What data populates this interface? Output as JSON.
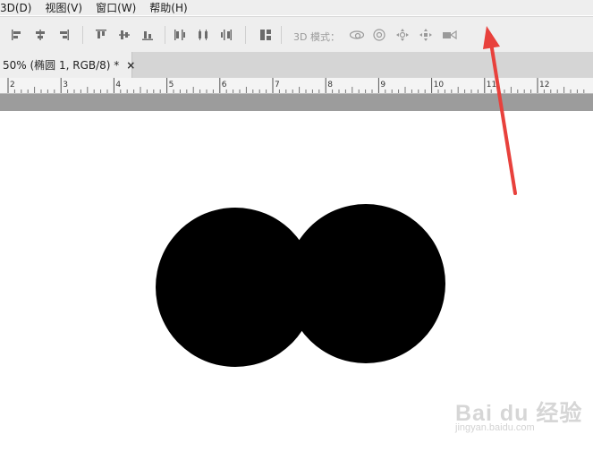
{
  "menubar": {
    "items": [
      {
        "label": "3D(D)"
      },
      {
        "label": "视图(V)"
      },
      {
        "label": "窗口(W)"
      },
      {
        "label": "帮助(H)"
      }
    ]
  },
  "options_bar": {
    "mode_label": "3D 模式：",
    "icons": [
      "align-left-edges-icon",
      "align-horizontal-centers-icon",
      "align-right-edges-icon",
      "align-top-edges-icon",
      "align-vertical-centers-icon",
      "align-bottom-edges-icon",
      "distribute-left-icon",
      "distribute-horizontal-centers-icon",
      "distribute-right-icon",
      "auto-align-layers-icon",
      "3d-orbit-icon",
      "3d-roll-icon",
      "3d-pan-icon",
      "3d-slide-icon",
      "3d-scale-icon"
    ]
  },
  "document_tab": {
    "label": "50% (椭圆 1, RGB/8) *",
    "close_label": "×"
  },
  "ruler": {
    "labels": [
      "2",
      "3",
      "4",
      "5",
      "6",
      "7",
      "8",
      "9",
      "10",
      "11",
      "12"
    ]
  },
  "canvas": {
    "shape_color": "#000000",
    "shapes": [
      "ellipse",
      "ellipse"
    ]
  },
  "annotation": {
    "arrow_color": "#e8413c"
  },
  "watermark": {
    "text": "Bai du 经验",
    "sub": "jingyan.baidu.com"
  }
}
